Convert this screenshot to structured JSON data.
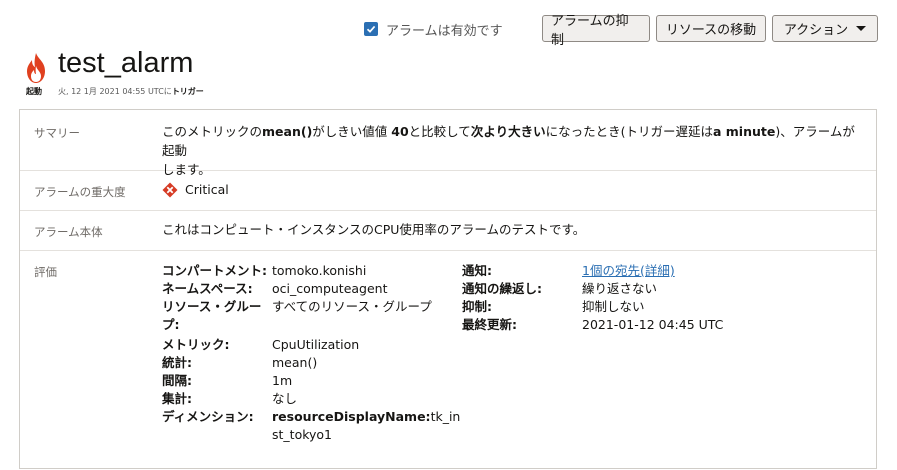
{
  "toolbar": {
    "enabled_label": "アラームは有効です",
    "suppress_label": "アラームの抑制",
    "move_label": "リソースの移動",
    "actions_label": "アクション"
  },
  "header": {
    "title": "test_alarm",
    "state": "起動",
    "subtitle_prefix": "火, 12 1月 2021 04:55 UTCに",
    "subtitle_bold": "トリガー"
  },
  "summary": {
    "label": "サマリー",
    "t1": "このメトリックの",
    "b1": "mean()",
    "t2": "がしきい値値 ",
    "b2": "40",
    "t3": "と比較して",
    "b3": "次より大きい",
    "t4": "になったとき(トリガー遅延は",
    "b4": "a minute",
    "t5": ")、アラームが起動",
    "line2": "します。"
  },
  "severity": {
    "label": "アラームの重大度",
    "value": "Critical"
  },
  "body_row": {
    "label": "アラーム本体",
    "value": "これはコンピュート・インスタンスのCPU使用率のアラームのテストです。"
  },
  "evaluation": {
    "label": "評価",
    "compartment_k": "コンパートメント:",
    "compartment_v": "tomoko.konishi",
    "namespace_k": "ネームスペース:",
    "namespace_v": "oci_computeagent",
    "resgroup_k1": "リソース・グルー",
    "resgroup_k2": "プ:",
    "resgroup_v": "すべてのリソース・グループ",
    "metric_k": "メトリック:",
    "metric_v": "CpuUtilization",
    "stat_k": "統計:",
    "stat_v": "mean()",
    "interval_k": "間隔:",
    "interval_v": "1m",
    "agg_k": "集計:",
    "agg_v": "なし",
    "dim_k": "ディメンション:",
    "dim_v_bold": "resourceDisplayName:",
    "dim_v1": "tk_in",
    "dim_v2": "st_tokyo1",
    "notify_k": "通知:",
    "notify_v": "1個の宛先(詳細)",
    "repeat_k": "通知の繰返し:",
    "repeat_v": "繰り返さない",
    "suppress_k": "抑制:",
    "suppress_v": "抑制しない",
    "updated_k": "最終更新:",
    "updated_v": "2021-01-12 04:45 UTC"
  },
  "colors": {
    "accent": "#2b6fb3",
    "critical": "#d63b25",
    "fire": "#e0401f"
  }
}
